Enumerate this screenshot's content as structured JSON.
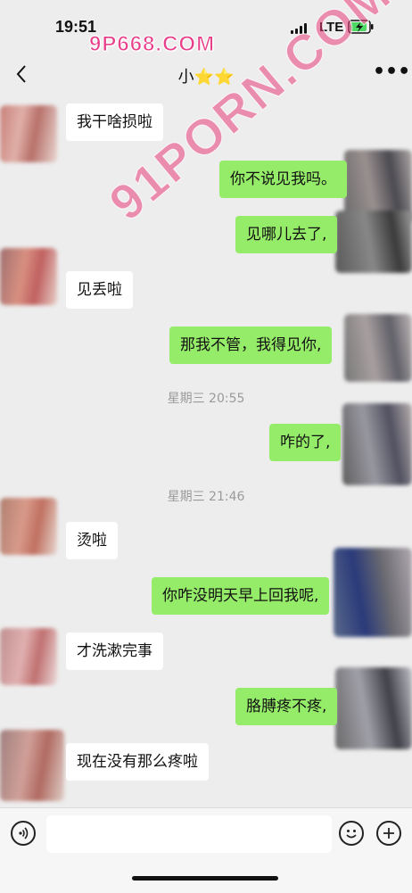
{
  "status_bar": {
    "time": "19:51",
    "network": "LTE",
    "battery_state": "charging",
    "icons": [
      "signal-icon",
      "battery-icon"
    ]
  },
  "watermarks": {
    "top": "9P668.COM",
    "diagonal": "91PORN.COM"
  },
  "header": {
    "title": "小⭐⭐",
    "icons": [
      "back-arrow-icon",
      "more-dots-icon"
    ],
    "more_label": "•••"
  },
  "messages": [
    {
      "side": "left",
      "text": "我干啥损啦"
    },
    {
      "side": "right",
      "text": "你不说见我吗。"
    },
    {
      "side": "right",
      "text": "见哪儿去了,"
    },
    {
      "side": "left",
      "text": "见丢啦"
    },
    {
      "side": "right",
      "text": "那我不管，我得见你,"
    },
    {
      "side": "right",
      "text": "咋的了,"
    },
    {
      "side": "left",
      "text": "烫啦"
    },
    {
      "side": "right",
      "text": "你咋没明天早上回我呢,"
    },
    {
      "side": "left",
      "text": "才洗漱完事"
    },
    {
      "side": "right",
      "text": "胳膊疼不疼,"
    },
    {
      "side": "left",
      "text": "现在没有那么疼啦"
    }
  ],
  "timestamps": [
    "星期三 20:55",
    "星期三 21:46"
  ],
  "input_bar": {
    "placeholder": "",
    "icons": [
      "voice-icon",
      "emoji-icon",
      "plus-icon"
    ]
  },
  "colors": {
    "background": "#ededed",
    "self_bubble": "#95ec69",
    "other_bubble": "#ffffff",
    "watermark": "#e8408a"
  }
}
